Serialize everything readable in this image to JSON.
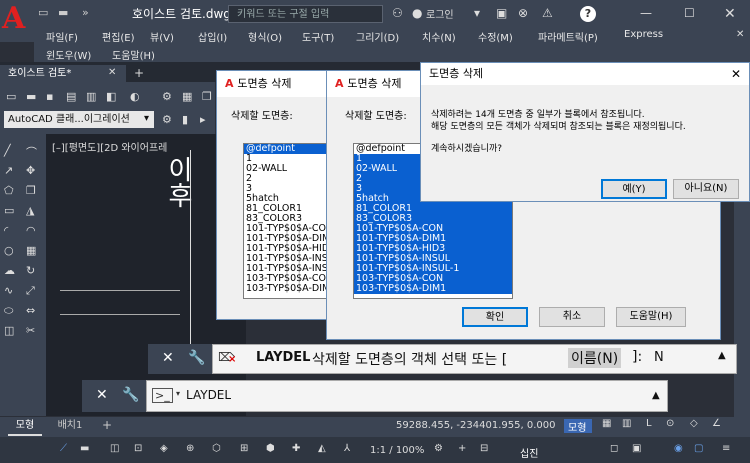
{
  "titlebar": {
    "app_name": "호이스트 검토.dwg",
    "search_placeholder": "키워드 또는 구절 입력",
    "login": "로그인",
    "help": "?"
  },
  "menu": [
    "파일(F)",
    "편집(E)",
    "뷰(V)",
    "삽입(I)",
    "형식(O)",
    "도구(T)",
    "그리기(D)",
    "치수(N)",
    "수정(M)",
    "파라메트릭(P)",
    "Express"
  ],
  "menu2": [
    "윈도우(W)",
    "도움말(H)"
  ],
  "doc_tab": "호이스트 검토*",
  "workspace_combo": "AutoCAD 클래...이그레이션",
  "view_label": "[–][평면도][2D 와이어프레",
  "canvas_text": "이후",
  "dialog1": {
    "title": "도면층 삭제",
    "label": "삭제할 도면층:",
    "items": [
      "@defpoint",
      "1",
      "02-WALL",
      "2",
      "3",
      "5hatch",
      "81_COLOR1",
      "83_COLOR3",
      "101-TYP$0$A-CO",
      "101-TYP$0$A-DIM",
      "101-TYP$0$A-HID",
      "101-TYP$0$A-INS",
      "101-TYP$0$A-INS",
      "103-TYP$0$A-CO",
      "103-TYP$0$A-DIM"
    ]
  },
  "dialog2": {
    "title": "도면층 삭제",
    "label": "삭제할 도면층:",
    "items": [
      "@defpoint",
      "1",
      "02-WALL",
      "2",
      "3",
      "5hatch",
      "81_COLOR1",
      "83_COLOR3",
      "101-TYP$0$A-CON",
      "101-TYP$0$A-DIM1",
      "101-TYP$0$A-HID3",
      "101-TYP$0$A-INSUL",
      "101-TYP$0$A-INSUL-1",
      "103-TYP$0$A-CON",
      "103-TYP$0$A-DIM1"
    ],
    "ok": "확인",
    "cancel": "취소",
    "help": "도움말(H)"
  },
  "dialog3": {
    "title": "도면층 삭제",
    "message1": "삭제하려는 14개 도면층 중 일부가 블록에서 참조됩니다.",
    "message2": "해당 도면층의 모든 객체가 삭제되며 참조되는 블록은 재정의됩니다.",
    "question": "계속하시겠습니까?",
    "yes": "예(Y)",
    "no": "아니요(N)"
  },
  "command1": {
    "cmd": "LAYDEL",
    "prompt": "삭제할 도면층의 객체 선택 또는 [",
    "option": "이름(N)",
    "tail": "]:",
    "input": "N"
  },
  "command2": {
    "cmd": "LAYDEL"
  },
  "status": {
    "model_tab": "모형",
    "layout_tab": "배치1",
    "coords": "59288.455, -234401.955, 0.000",
    "model_label": "모형",
    "scale": "1:1 / 100%",
    "decimal": "십진"
  },
  "colors": {
    "accent": "#0a60d0",
    "brand": "#e02020"
  }
}
